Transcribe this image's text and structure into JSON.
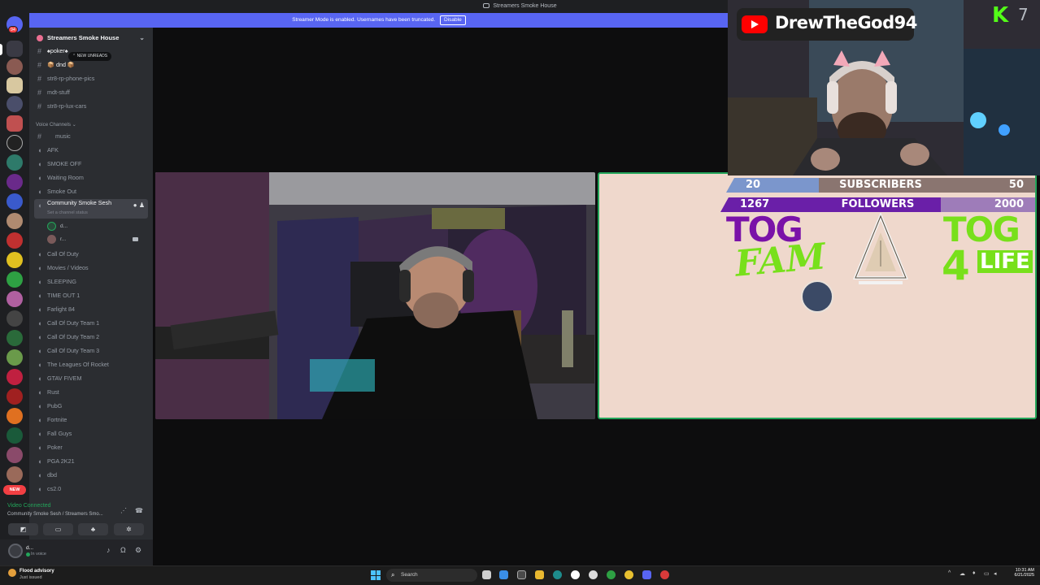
{
  "titlebar": {
    "title": "Streamers Smoke House"
  },
  "banner": {
    "text": "Streamer Mode is enabled. Usernames have been truncated.",
    "disable_label": "Disable"
  },
  "server_rail": {
    "badge_top": "94",
    "new_label": "NEW"
  },
  "sidebar": {
    "server_name": "Streamers Smoke House",
    "new_unreads": "NEW UNREADS",
    "text_channels": [
      {
        "name": "♠poker♠"
      },
      {
        "name": "📦 dnd 📦"
      },
      {
        "name": "str8-rp-phone-pics"
      },
      {
        "name": "mdt-stuff"
      },
      {
        "name": "str8-rp-lux-cars"
      }
    ],
    "voice_category": "Voice Channels",
    "music_channel": "music",
    "voice_channels_top": [
      "AFK",
      "SMOKE OFF",
      "Waiting Room",
      "Smoke Out"
    ],
    "active_channel": "Community Smoke Sesh",
    "active_subtitle": "Set a channel status",
    "voice_users": [
      "d...",
      "r..."
    ],
    "voice_channels_bottom": [
      "Call Of Duty",
      "Movies / Videos",
      "SLEEPING",
      "TIME OUT 1",
      "Farlight 84",
      "Call Of Duty Team 1",
      "Call Of Duty Team 2",
      "Call Of Duty Team 3",
      "The Leagues Of Rocket",
      "GTAV FIVEM",
      "Rust",
      "PubG",
      "Fortnite",
      "Fall Guys",
      "Poker",
      "PGA 2K21",
      "dbd",
      "cs2.0"
    ]
  },
  "voice_panel": {
    "status": "Video Connected",
    "location": "Community Smoke Sesh / Streamers Smo..."
  },
  "user": {
    "name": "d...",
    "status": "In voice"
  },
  "overlay": {
    "channel_name": "DrewTheGod94",
    "kick_count": "7",
    "subscribers": {
      "current": "20",
      "label": "SUBSCRIBERS",
      "goal": "50"
    },
    "followers": {
      "current": "1267",
      "label": "FOLLOWERS",
      "goal": "2000"
    },
    "tog_left": "TOG",
    "fam": "FAM",
    "tog_right": "TOG",
    "four": "4",
    "life": "LIFE"
  },
  "taskbar": {
    "weather_title": "Flood advisory",
    "weather_sub": "Just issued",
    "search_label": "Search",
    "time": "10:31 AM",
    "date": "6/21/2025"
  },
  "colors": {
    "accent": "#5865f2",
    "connected": "#23a55a",
    "kick": "#53fc18",
    "tog_purple": "#7a12a8",
    "tog_green": "#78e01b"
  }
}
